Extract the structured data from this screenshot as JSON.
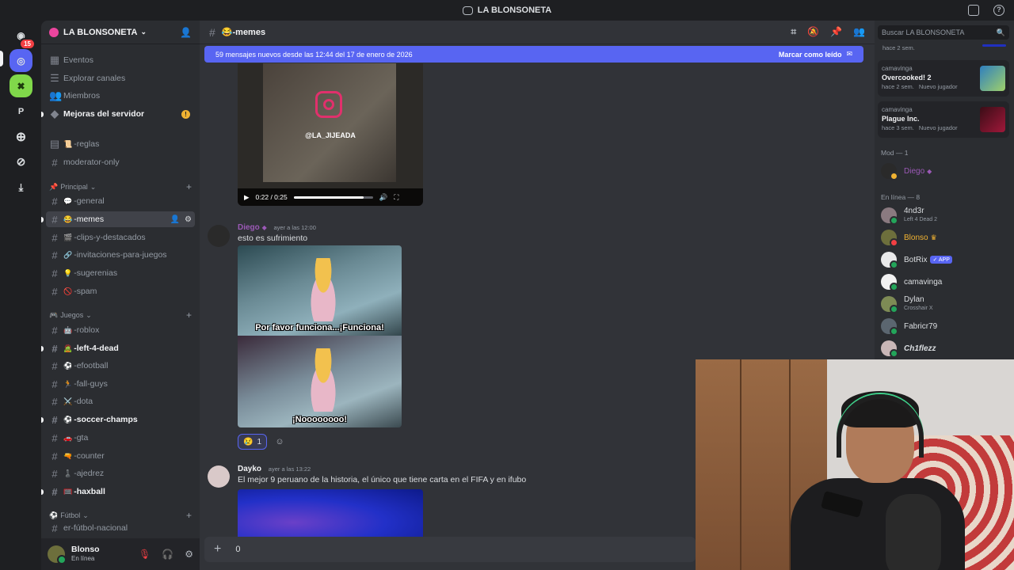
{
  "window": {
    "title": "LA BLONSONETA"
  },
  "rail": {
    "badge": "15",
    "letter": "P"
  },
  "server": {
    "name": "LA BLONSONETA"
  },
  "sidebar": {
    "top_items": [
      {
        "label": "Eventos"
      },
      {
        "label": "Explorar canales"
      },
      {
        "label": "Miembros"
      },
      {
        "label": "Mejoras del servidor",
        "warn": "!"
      }
    ],
    "channels_top": [
      {
        "emoji": "📜",
        "label": "-reglas"
      },
      {
        "emoji": "",
        "label": "moderator-only"
      }
    ],
    "categories": [
      {
        "label": "Principal"
      },
      {
        "label": "Juegos"
      },
      {
        "label": "Fútbol"
      }
    ],
    "principal": [
      {
        "emoji": "💬",
        "label": "-general"
      },
      {
        "emoji": "😂",
        "label": "-memes"
      },
      {
        "emoji": "🎬",
        "label": "-clips-y-destacados"
      },
      {
        "emoji": "🔗",
        "label": "-invitaciones-para-juegos"
      },
      {
        "emoji": "💡",
        "label": "-sugerenias"
      },
      {
        "emoji": "🚫",
        "label": "-spam"
      }
    ],
    "juegos": [
      {
        "emoji": "🤖",
        "label": "-roblox"
      },
      {
        "emoji": "🧟",
        "label": "-left-4-dead"
      },
      {
        "emoji": "⚽",
        "label": "-efootball"
      },
      {
        "emoji": "🏃",
        "label": "-fall-guys"
      },
      {
        "emoji": "⚔️",
        "label": "-dota"
      },
      {
        "emoji": "⚽",
        "label": "-soccer-champs"
      },
      {
        "emoji": "🚗",
        "label": "-gta"
      },
      {
        "emoji": "🔫",
        "label": "-counter"
      },
      {
        "emoji": "♟️",
        "label": "-ajedrez"
      },
      {
        "emoji": "🥅",
        "label": "-haxball"
      }
    ],
    "futbol": [
      {
        "emoji": "",
        "label": "er-fútbol-nacional"
      }
    ]
  },
  "user": {
    "name": "Blonso",
    "status": "En línea"
  },
  "channel": {
    "name": "-memes",
    "emoji": "😂"
  },
  "new_messages_bar": {
    "text": "59 mensajes nuevos desde las 12:44 del 17 de enero de 2026",
    "action": "Marcar como leído"
  },
  "video": {
    "handle": "@LA_JIJEADA",
    "time": "0:22 / 0:25",
    "progress": 0.88
  },
  "messages": [
    {
      "author": "Diego",
      "time": "ayer a las 12:00",
      "text": "esto es sufrimiento",
      "meme_captions": [
        "Por favor funciona...¡Funciona!",
        "¡Noooooooo!"
      ],
      "reaction": {
        "emoji": "😢",
        "count": "1"
      }
    },
    {
      "author": "Dayko",
      "time": "ayer a las 13:22",
      "text": "El mejor 9 peruano de la historia, el único que tiene carta en el FIFA y en ifubo"
    }
  ],
  "composer": {
    "value": "0"
  },
  "members": {
    "search_placeholder": "Buscar LA BLONSONETA",
    "top_time": "hace 2 sem.",
    "activities": [
      {
        "user": "camavinga",
        "game": "Overcooked! 2",
        "meta": "hace 2 sem.",
        "tag": "Nuevo jugador"
      },
      {
        "user": "camavinga",
        "game": "Plague Inc.",
        "meta": "hace 3 sem.",
        "tag": "Nuevo jugador"
      }
    ],
    "mod_header": "Mod — 1",
    "online_header": "En línea — 8",
    "mod": [
      {
        "name": "Diego"
      }
    ],
    "online": [
      {
        "name": "4nd3r",
        "sub": "Left 4 Dead 2"
      },
      {
        "name": "Blonso",
        "sub": ""
      },
      {
        "name": "BotRix",
        "sub": "",
        "tag": "✓ APP"
      },
      {
        "name": "camavinga",
        "sub": ""
      },
      {
        "name": "Dylan",
        "sub": "Crosshair X"
      },
      {
        "name": "Fabricr79",
        "sub": ""
      },
      {
        "name": "Ch1flezz",
        "sub": ""
      }
    ]
  },
  "colors": {
    "accent": "#5865f2",
    "mod_name": "#9b59b6",
    "owner_name": "#f0b232",
    "online": "#23a55a"
  }
}
